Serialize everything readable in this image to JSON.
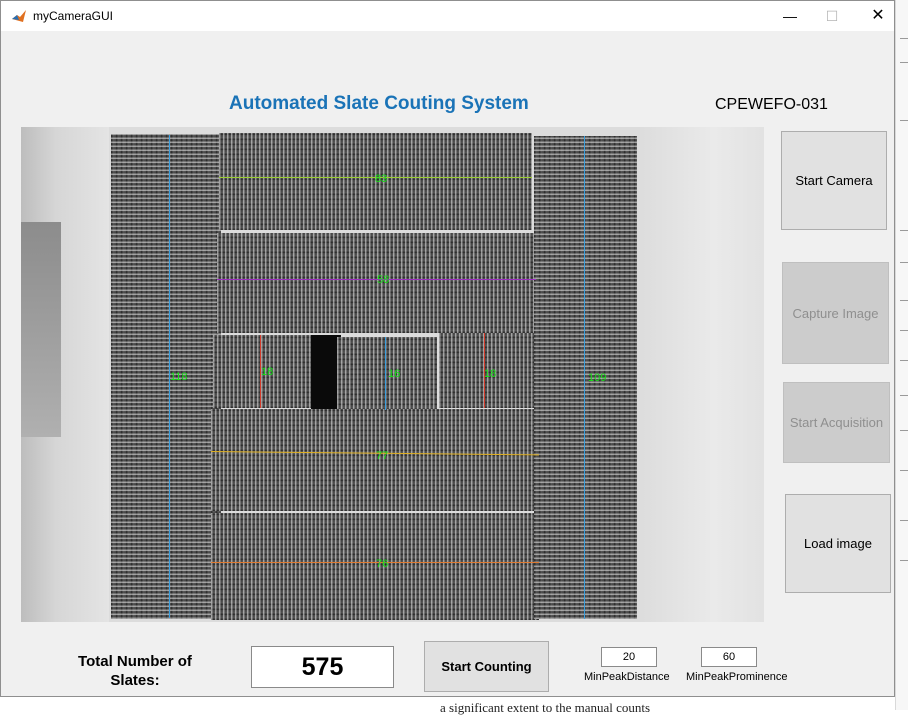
{
  "window": {
    "title": "myCameraGUI",
    "minimize_glyph": "—",
    "maximize_glyph": "☐",
    "close_glyph": "✕"
  },
  "header": {
    "app_title": "Automated Slate Couting System",
    "code": "CPEWEFO-031",
    "title_color": "#1a73b7"
  },
  "image": {
    "counts": [
      {
        "id": "top-block",
        "value": "83",
        "line_color": "#9acd32"
      },
      {
        "id": "second-block",
        "value": "58",
        "line_color": "#9b30c0"
      },
      {
        "id": "left-column",
        "value": "118",
        "line_color": "#3aa0e0"
      },
      {
        "id": "middle-left",
        "value": "18",
        "line_color": "#d43a2a"
      },
      {
        "id": "middle-center",
        "value": "16",
        "line_color": "#3aa0e0"
      },
      {
        "id": "middle-right",
        "value": "18",
        "line_color": "#d43a2a"
      },
      {
        "id": "right-column",
        "value": "109",
        "line_color": "#3aa0e0"
      },
      {
        "id": "fourth-block",
        "value": "77",
        "line_color": "#e0b020"
      },
      {
        "id": "bottom-block",
        "value": "76",
        "line_color": "#e07a30"
      }
    ],
    "label_color": "#16e016"
  },
  "buttons": {
    "start_camera": "Start Camera",
    "capture_image": "Capture Image",
    "start_acquisition": "Start Acquisition",
    "load_image": "Load image",
    "start_counting": "Start  Counting"
  },
  "footer": {
    "total_label": "Total Number of Slates:",
    "total_value": "575",
    "min_peak_distance_value": "20",
    "min_peak_distance_label": "MinPeakDistance",
    "min_peak_prominence_value": "60",
    "min_peak_prominence_label": "MinPeakProminence"
  },
  "background_doc": {
    "bottom_text": "a significant extent to the manual counts"
  },
  "icons": {
    "app_icon": "matlab-icon"
  }
}
